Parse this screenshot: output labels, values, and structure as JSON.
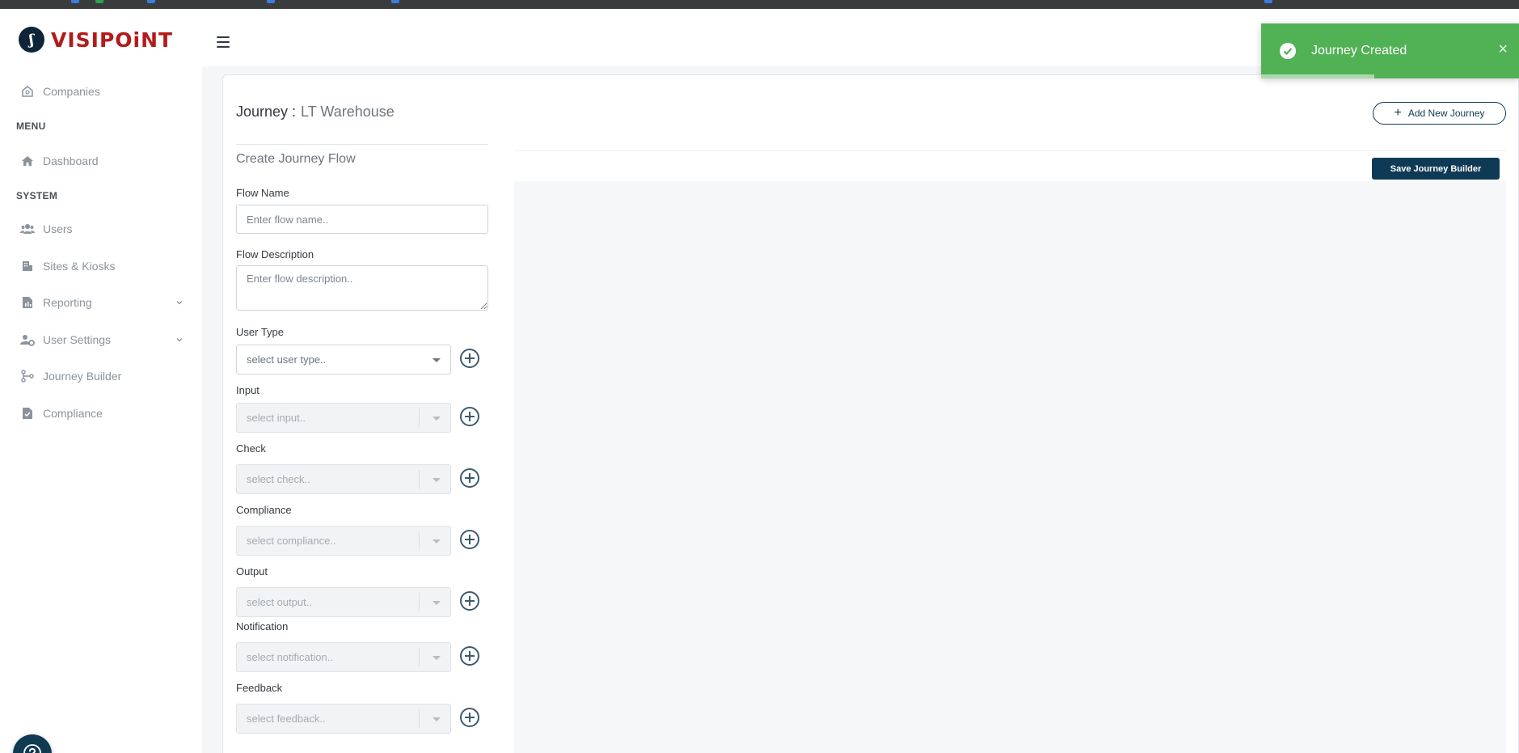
{
  "app": {
    "logo_text": "VISIPOiNT"
  },
  "colors": {
    "brand_navy": "#0f3a55",
    "brand_red": "#b31b1b",
    "toast_green": "#51b155"
  },
  "sidebar": {
    "top_item": {
      "label": "Companies",
      "icon": "building-icon"
    },
    "menu_header": "MENU",
    "menu_items": [
      {
        "label": "Dashboard",
        "icon": "home-icon"
      }
    ],
    "system_header": "SYSTEM",
    "system_items": [
      {
        "label": "Users",
        "icon": "users-icon"
      },
      {
        "label": "Sites & Kiosks",
        "icon": "building-icon"
      },
      {
        "label": "Reporting",
        "icon": "report-icon",
        "has_submenu": true
      },
      {
        "label": "User Settings",
        "icon": "user-gear-icon",
        "has_submenu": true
      },
      {
        "label": "Journey Builder",
        "icon": "branch-icon"
      },
      {
        "label": "Compliance",
        "icon": "file-check-icon"
      }
    ]
  },
  "journey": {
    "title_label": "Journey :",
    "title_value": "LT Warehouse",
    "add_button": "Add New Journey"
  },
  "form": {
    "section_title": "Create Journey Flow",
    "flow_name": {
      "label": "Flow Name",
      "placeholder": "Enter flow name.."
    },
    "flow_description": {
      "label": "Flow Description",
      "placeholder": "Enter flow description.."
    },
    "selects": [
      {
        "label": "User Type",
        "placeholder": "select user type..",
        "enabled": true
      },
      {
        "label": "Input",
        "placeholder": "select input..",
        "enabled": false
      },
      {
        "label": "Check",
        "placeholder": "select check..",
        "enabled": false
      },
      {
        "label": "Compliance",
        "placeholder": "select compliance..",
        "enabled": false
      },
      {
        "label": "Output",
        "placeholder": "select output..",
        "enabled": false
      },
      {
        "label": "Notification",
        "placeholder": "select notification..",
        "enabled": false
      },
      {
        "label": "Feedback",
        "placeholder": "select feedback..",
        "enabled": false
      }
    ]
  },
  "canvas": {
    "save_button": "Save Journey Builder"
  },
  "toast": {
    "message": "Journey Created",
    "close": "×",
    "progress": 0.44
  }
}
